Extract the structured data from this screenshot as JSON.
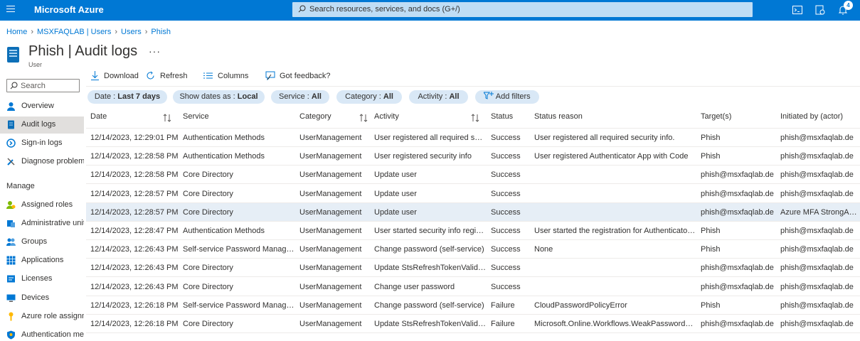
{
  "topbar": {
    "brand": "Microsoft Azure",
    "search_placeholder": "Search resources, services, and docs (G+/)",
    "notification_count": "4",
    "icons": [
      "menu-icon",
      "search-icon",
      "cloud-shell-icon",
      "directory-filter-icon",
      "bell-icon"
    ]
  },
  "breadcrumb": [
    "Home",
    "MSXFAQLAB | Users",
    "Users",
    "Phish"
  ],
  "header": {
    "title": "Phish | Audit logs",
    "more": "···",
    "subtitle": "User"
  },
  "sidebar": {
    "search_placeholder": "Search",
    "items": [
      {
        "label": "Overview",
        "icon": "person-icon",
        "active": false
      },
      {
        "label": "Audit logs",
        "icon": "document-icon",
        "active": true
      },
      {
        "label": "Sign-in logs",
        "icon": "sign-in-icon",
        "active": false
      },
      {
        "label": "Diagnose problems",
        "icon": "wrench-icon",
        "active": false
      }
    ],
    "manage_label": "Manage",
    "manage_items": [
      {
        "label": "Assigned roles",
        "icon": "roles-icon"
      },
      {
        "label": "Administrative units",
        "icon": "admin-units-icon"
      },
      {
        "label": "Groups",
        "icon": "groups-icon"
      },
      {
        "label": "Applications",
        "icon": "apps-grid-icon"
      },
      {
        "label": "Licenses",
        "icon": "license-icon"
      },
      {
        "label": "Devices",
        "icon": "device-icon"
      },
      {
        "label": "Azure role assignments",
        "icon": "key-icon"
      },
      {
        "label": "Authentication methods",
        "icon": "shield-icon"
      }
    ]
  },
  "toolbar": {
    "download": "Download",
    "refresh": "Refresh",
    "columns": "Columns",
    "feedback": "Got feedback?"
  },
  "filters": [
    {
      "label": "Date : ",
      "value": "Last 7 days"
    },
    {
      "label": "Show dates as : ",
      "value": "Local"
    },
    {
      "label": "Service : ",
      "value": "All"
    },
    {
      "label": "Category : ",
      "value": "All"
    },
    {
      "label": "Activity : ",
      "value": "All"
    },
    {
      "label": "Add filters",
      "value": ""
    }
  ],
  "table": {
    "columns": [
      "Date",
      "Service",
      "Category",
      "Activity",
      "Status",
      "Status reason",
      "Target(s)",
      "Initiated by (actor)"
    ],
    "rows": [
      [
        "12/14/2023, 12:29:01 PM",
        "Authentication Methods",
        "UserManagement",
        "User registered all required sec...",
        "Success",
        "User registered all required security info.",
        "Phish",
        "phish@msxfaqlab.de"
      ],
      [
        "12/14/2023, 12:28:58 PM",
        "Authentication Methods",
        "UserManagement",
        "User registered security info",
        "Success",
        "User registered Authenticator App with Code",
        "Phish",
        "phish@msxfaqlab.de"
      ],
      [
        "12/14/2023, 12:28:58 PM",
        "Core Directory",
        "UserManagement",
        "Update user",
        "Success",
        "",
        "phish@msxfaqlab.de",
        "phish@msxfaqlab.de"
      ],
      [
        "12/14/2023, 12:28:57 PM",
        "Core Directory",
        "UserManagement",
        "Update user",
        "Success",
        "",
        "phish@msxfaqlab.de",
        "phish@msxfaqlab.de"
      ],
      [
        "12/14/2023, 12:28:57 PM",
        "Core Directory",
        "UserManagement",
        "Update user",
        "Success",
        "",
        "phish@msxfaqlab.de",
        "Azure MFA StrongAuthe"
      ],
      [
        "12/14/2023, 12:28:47 PM",
        "Authentication Methods",
        "UserManagement",
        "User started security info regist...",
        "Success",
        "User started the registration for Authenticator ...",
        "Phish",
        "phish@msxfaqlab.de"
      ],
      [
        "12/14/2023, 12:26:43 PM",
        "Self-service Password Manage...",
        "UserManagement",
        "Change password (self-service)",
        "Success",
        "None",
        "Phish",
        "phish@msxfaqlab.de"
      ],
      [
        "12/14/2023, 12:26:43 PM",
        "Core Directory",
        "UserManagement",
        "Update StsRefreshTokenValidFr...",
        "Success",
        "",
        "phish@msxfaqlab.de",
        "phish@msxfaqlab.de"
      ],
      [
        "12/14/2023, 12:26:43 PM",
        "Core Directory",
        "UserManagement",
        "Change user password",
        "Success",
        "",
        "phish@msxfaqlab.de",
        "phish@msxfaqlab.de"
      ],
      [
        "12/14/2023, 12:26:18 PM",
        "Self-service Password Manage...",
        "UserManagement",
        "Change password (self-service)",
        "Failure",
        "CloudPasswordPolicyError",
        "Phish",
        "phish@msxfaqlab.de"
      ],
      [
        "12/14/2023, 12:26:18 PM",
        "Core Directory",
        "UserManagement",
        "Update StsRefreshTokenValidFr...",
        "Failure",
        "Microsoft.Online.Workflows.WeakPasswordExc...",
        "phish@msxfaqlab.de",
        "phish@msxfaqlab.de"
      ]
    ],
    "selected_row": 4
  },
  "colors": {
    "accent": "#0078d4",
    "pill": "#d9e8f6",
    "selected_row": "#e6eef6"
  }
}
